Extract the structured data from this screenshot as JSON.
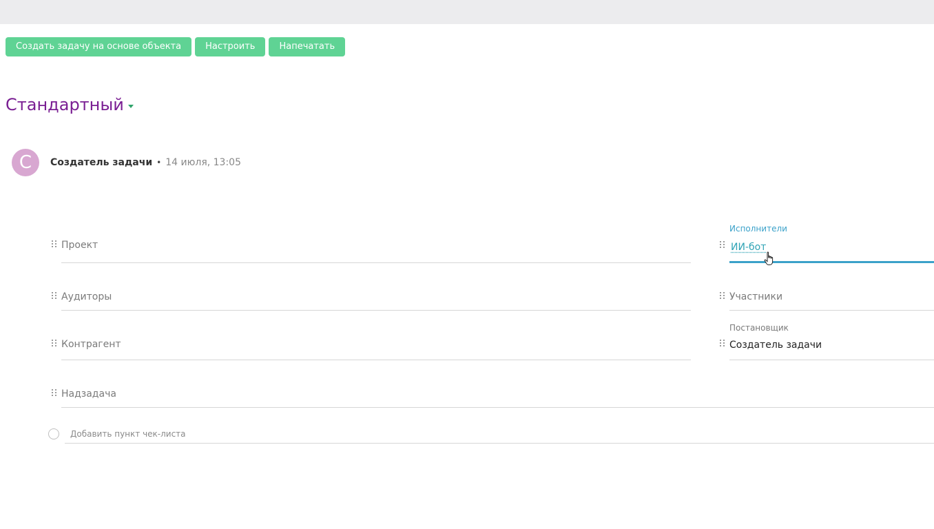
{
  "toolbar": {
    "create_task_label": "Создать задачу на основе объекта",
    "configure_label": "Настроить",
    "print_label": "Напечатать"
  },
  "view": {
    "title": "Стандартный"
  },
  "author": {
    "avatar_letter": "С",
    "name": "Создатель задачи",
    "separator": "•",
    "time": "14 июля, 13:05"
  },
  "fields": {
    "project": "Проект",
    "auditors": "Аудиторы",
    "counterparty": "Контрагент",
    "parent_task": "Надзадача",
    "executors_caption": "Исполнители",
    "executors_value": "ИИ-бот",
    "participants": "Участники",
    "setter_caption": "Постановщик",
    "setter_value": "Создатель задачи"
  },
  "checklist": {
    "placeholder": "Добавить пункт чек-листа"
  },
  "colors": {
    "button_bg": "#5fd394",
    "title": "#7a1f93",
    "link": "#2fa3b5",
    "active_underline": "#3aa1c9"
  }
}
